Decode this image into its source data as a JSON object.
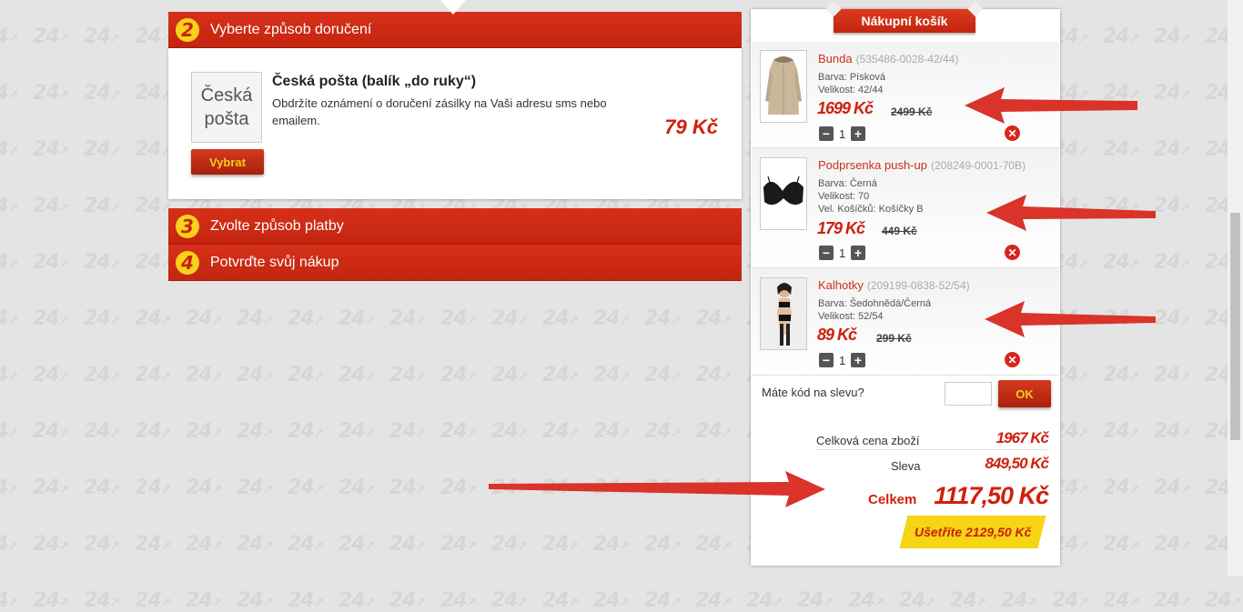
{
  "steps": [
    {
      "num": "2",
      "label": "Vyberte způsob doručení"
    },
    {
      "num": "3",
      "label": "Zvolte způsob platby"
    },
    {
      "num": "4",
      "label": "Potvrďte svůj nákup"
    }
  ],
  "delivery": {
    "logo_line1": "Česká",
    "logo_line2": "pošta",
    "select_label": "Vybrat",
    "title": "Česká pošta (balík „do ruky“)",
    "description": "Obdržíte oznámení o doručení zásilky na Vaši adresu sms nebo emailem.",
    "price": "79 Kč"
  },
  "cart": {
    "title": "Nákupní košík",
    "items": [
      {
        "name": "Bunda",
        "code": "(535486-0028-42/44)",
        "attrs": [
          "Barva: Písková",
          "Velikost: 42/44"
        ],
        "price": "1699 Kč",
        "old_price": "2499 Kč",
        "qty": "1",
        "thumb_icon": "jacket-icon"
      },
      {
        "name": "Podprsenka push-up",
        "code": "(208249-0001-70B)",
        "attrs": [
          "Barva: Černá",
          "Velikost: 70",
          "Vel. Košíčků: Košíčky B"
        ],
        "price": "179 Kč",
        "old_price": "449 Kč",
        "qty": "1",
        "thumb_icon": "bra-icon"
      },
      {
        "name": "Kalhotky",
        "code": "(209199-0838-52/54)",
        "attrs": [
          "Barva: Šedohnědá/Černá",
          "Velikost: 52/54"
        ],
        "price": "89 Kč",
        "old_price": "299 Kč",
        "qty": "1",
        "thumb_icon": "lingerie-model-icon"
      }
    ],
    "promo_label": "Máte kód na slevu?",
    "promo_value": "",
    "promo_ok": "OK",
    "total_goods_label": "Celková cena zboží",
    "total_goods": "1967 Kč",
    "discount_label": "Sleva",
    "discount": "849,50 Kč",
    "total_label": "Celkem",
    "total": "1117,50 Kč",
    "savings": "Ušetříte 2129,50 Kč"
  },
  "watermark": "24",
  "colors": {
    "brand_red": "#c9301b",
    "price_red": "#d0200c",
    "accent_yellow": "#f5d514",
    "arrow_red": "#d9332a"
  }
}
